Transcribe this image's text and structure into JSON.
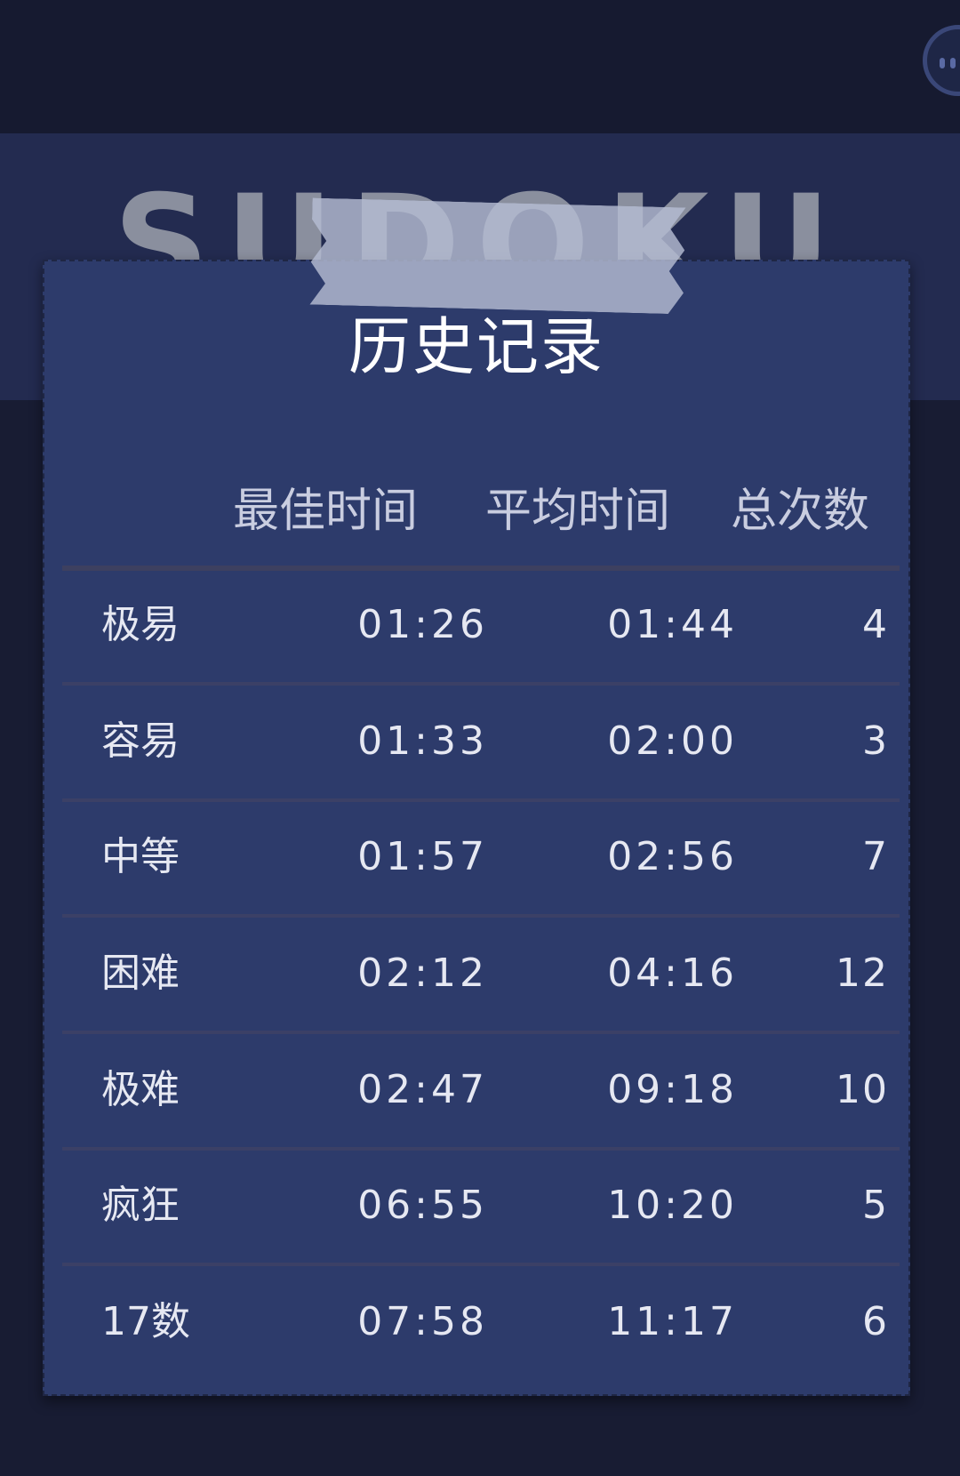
{
  "background_title": "SUDOKU",
  "dialog": {
    "title": "历史记录",
    "columns": [
      "最佳时间",
      "平均时间",
      "总次数"
    ],
    "rows": [
      {
        "level": "极易",
        "best": "01:26",
        "avg": "01:44",
        "count": "4"
      },
      {
        "level": "容易",
        "best": "01:33",
        "avg": "02:00",
        "count": "3"
      },
      {
        "level": "中等",
        "best": "01:57",
        "avg": "02:56",
        "count": "7"
      },
      {
        "level": "困难",
        "best": "02:12",
        "avg": "04:16",
        "count": "12"
      },
      {
        "level": "极难",
        "best": "02:47",
        "avg": "09:18",
        "count": "10"
      },
      {
        "level": "疯狂",
        "best": "06:55",
        "avg": "10:20",
        "count": "5"
      },
      {
        "level": "17数",
        "best": "07:58",
        "avg": "11:17",
        "count": "6"
      }
    ]
  },
  "colors": {
    "background": "#181c33",
    "card": "#2d3b6b",
    "text": "#e6e8f2"
  }
}
